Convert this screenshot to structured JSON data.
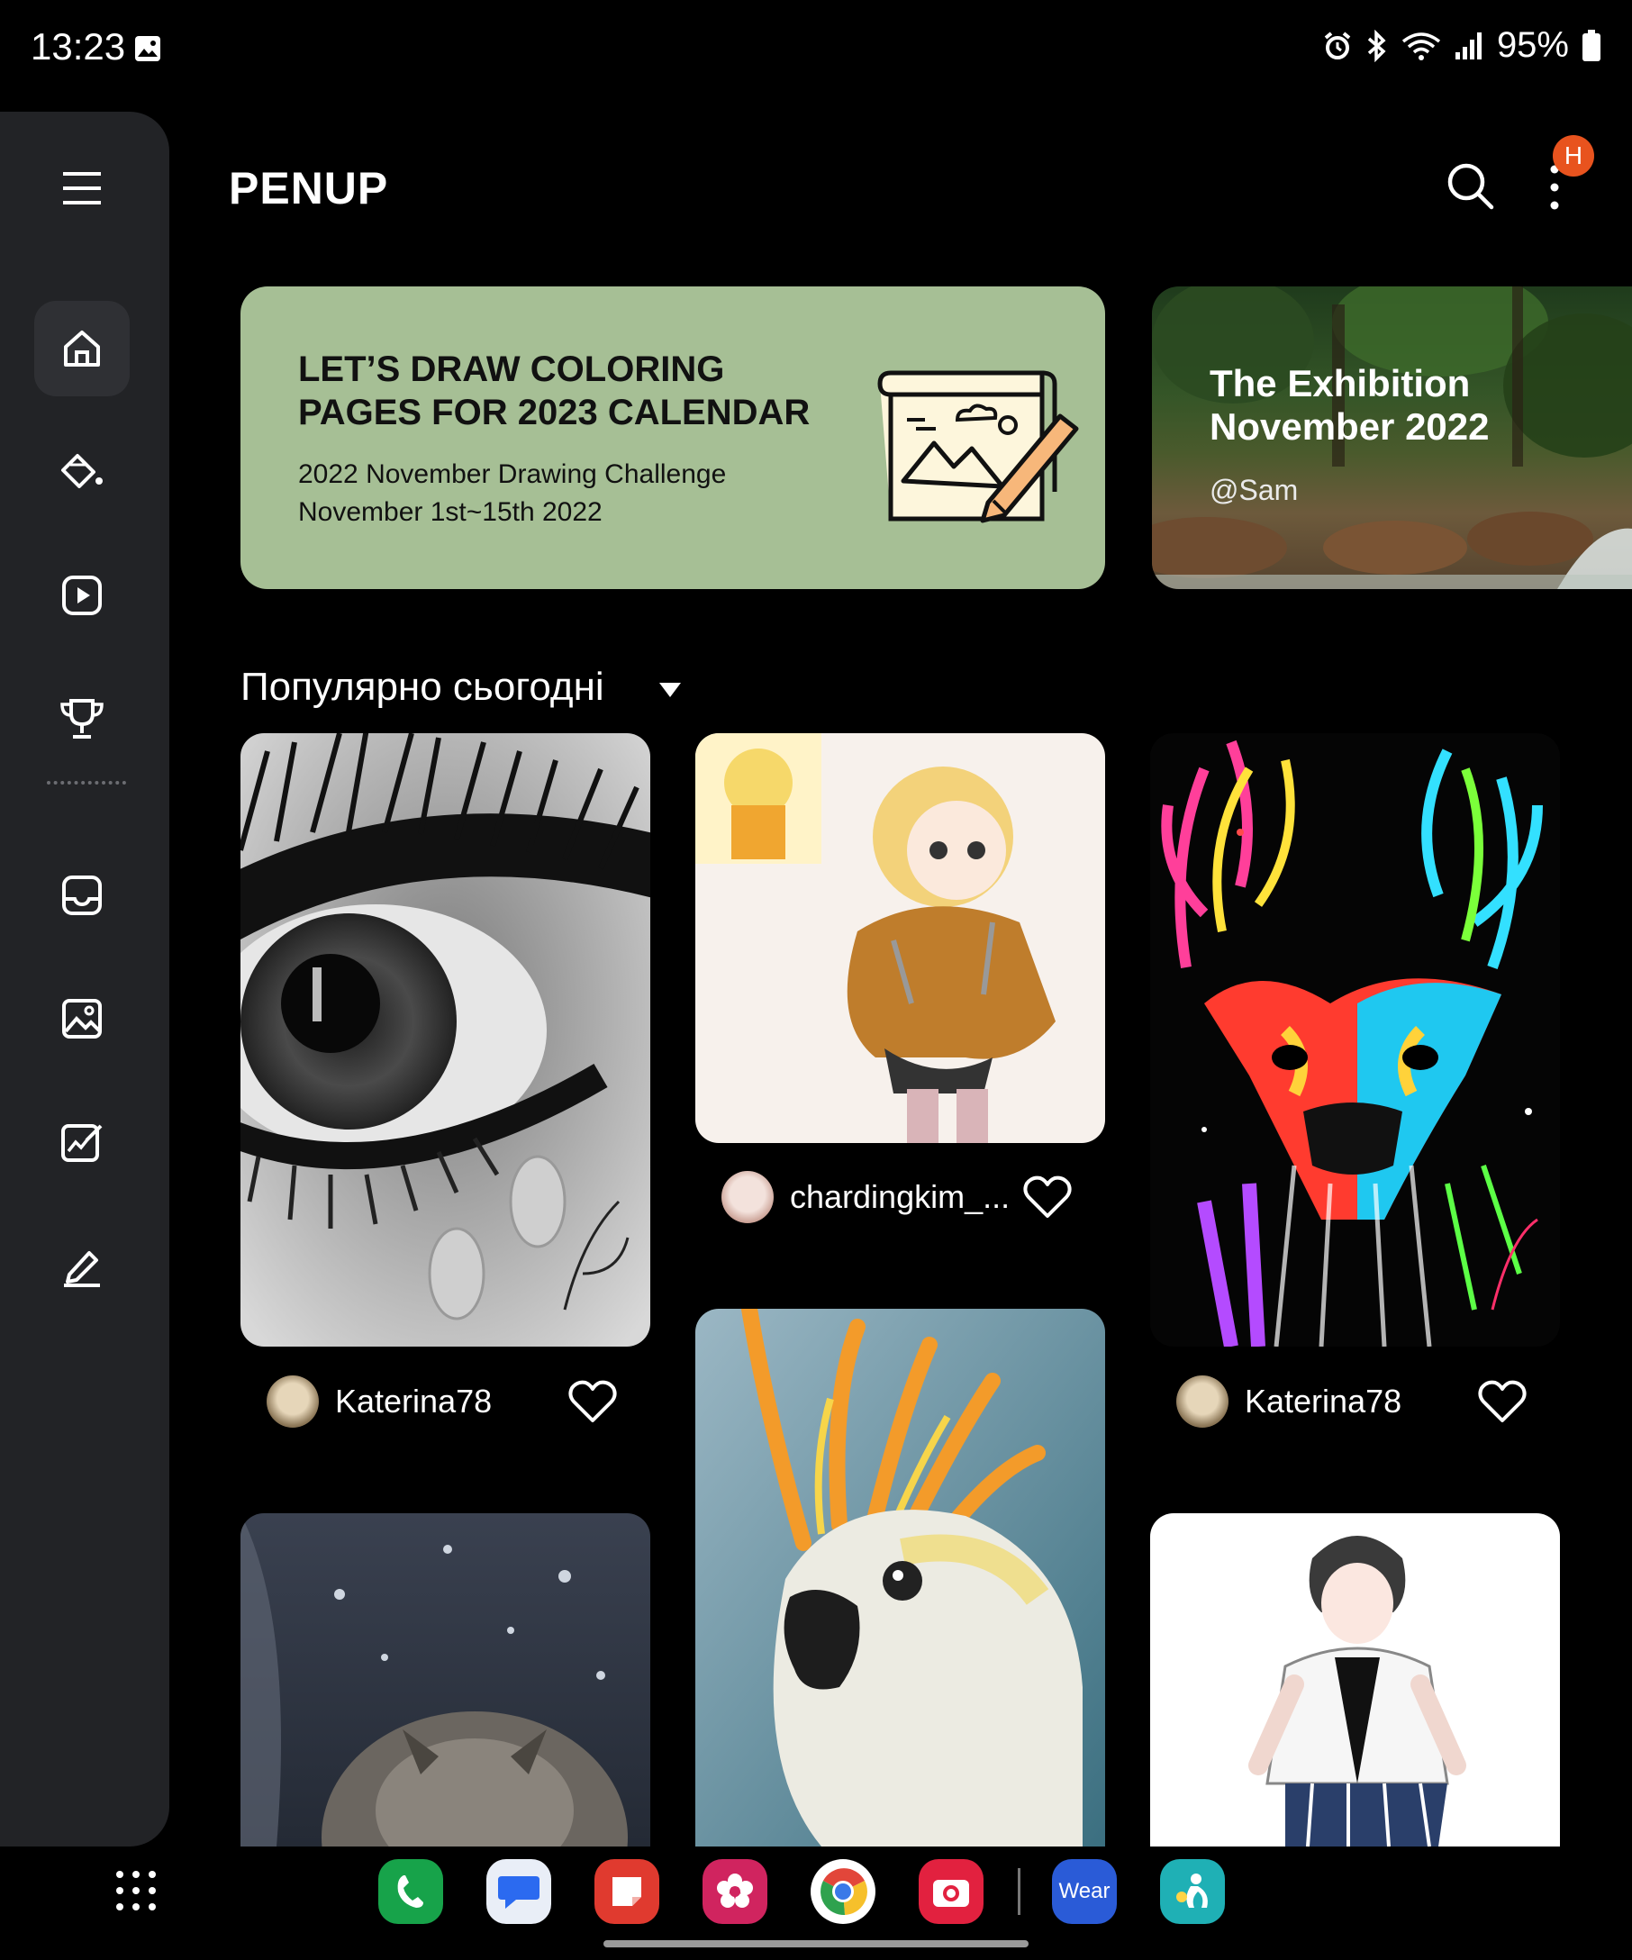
{
  "status_bar": {
    "time": "13:23",
    "battery": "95%",
    "icons": [
      "gallery-icon",
      "alarm-icon",
      "bluetooth-icon",
      "wifi-icon",
      "signal-icon",
      "battery-icon"
    ]
  },
  "app_bar": {
    "title": "PENUP",
    "notification_badge": "H"
  },
  "nav_rail": {
    "items": [
      "menu-icon",
      "home-icon",
      "coloring-icon",
      "live-drawing-icon",
      "challenge-trophy-icon",
      "inbox-icon",
      "gallery-icon",
      "drawing-icon",
      "draw-icon"
    ]
  },
  "banners": {
    "challenge": {
      "title": "LET’S DRAW COLORING PAGES FOR 2023 CALENDAR",
      "subtitle_line1": "2022 November Drawing Challenge",
      "subtitle_line2": "November 1st~15th 2022",
      "background": "#a6bf95"
    },
    "exhibition": {
      "title": "The Exhibition November 2022",
      "author": "@Sam"
    }
  },
  "section": {
    "title": "Популярно сьогодні"
  },
  "cards": [
    {
      "user": "Katerina78"
    },
    {
      "user": "chardingkim_..."
    },
    {
      "user": "Katerina78"
    }
  ],
  "dock": {
    "apps": [
      "phone-icon",
      "messages-icon",
      "notes-icon",
      "gallery-blossom-icon",
      "chrome-icon",
      "camera-icon",
      "wear-icon",
      "kids-icon"
    ],
    "wear_label": "Wear"
  }
}
